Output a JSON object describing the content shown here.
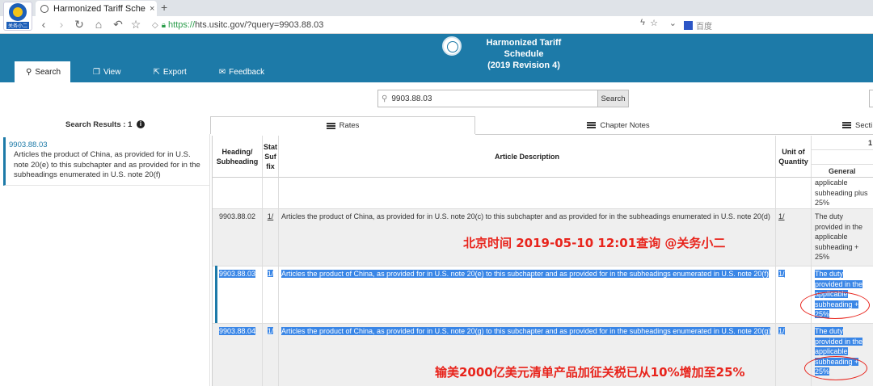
{
  "browser": {
    "logo_text": "关务小二",
    "tab_title": "Harmonized Tariff Sche",
    "tab_close": "×",
    "new_tab": "+",
    "url_scheme": "https://",
    "url_rest": "hts.usitc.gov/?query=9903.88.03",
    "search_engine": "百度"
  },
  "site": {
    "title_line1": "Harmonized Tariff Schedule",
    "title_line2": "(2019 Revision 4)",
    "menu": [
      {
        "label": "Search",
        "icon": "search-icon",
        "active": true
      },
      {
        "label": "View",
        "icon": "copy-icon"
      },
      {
        "label": "Export",
        "icon": "export-icon"
      },
      {
        "label": "Feedback",
        "icon": "feedback-icon"
      }
    ]
  },
  "search": {
    "value": "9903.88.03",
    "button": "Search"
  },
  "results": {
    "header": "Search Results : 1",
    "info_icon": "i",
    "item_code": "9903.88.03",
    "item_desc": "Articles the product of China, as provided for in U.S. note 20(e) to this subchapter and as provided for in the subheadings enumerated in U.S. note 20(f)"
  },
  "subtabs": [
    "Rates",
    "Chapter Notes",
    "Secti"
  ],
  "table": {
    "headers": {
      "heading": "Heading/ Subheading",
      "stat": "Stat Suf fix",
      "desc": "Article Description",
      "unit": "Unit of Quantity",
      "rates_top": "1",
      "general": "General"
    },
    "rows": [
      {
        "heading": "",
        "stat": "",
        "desc": "",
        "unit": "",
        "general": "applicable subheading plus 25%"
      },
      {
        "heading": "9903.88.02",
        "stat": "1/",
        "desc": "Articles the product of China, as provided for in U.S. note 20(c) to this subchapter and as provided for in the subheadings enumerated in U.S. note 20(d)",
        "unit": "1/",
        "general": "The duty provided in the applicable subheading + 25%"
      },
      {
        "heading": "9903.88.03",
        "stat": "1/",
        "desc": "Articles the product of China, as provided for in U.S. note 20(e) to this subchapter and as provided for in the subheadings enumerated in U.S. note 20(f)",
        "unit": "1/",
        "general": "The duty provided in the applicable subheading + 25%"
      },
      {
        "heading": "9903.88.04",
        "stat": "1/",
        "desc": "Articles the product of China, as provided for in U.S. note 20(g) to this subchapter and as provided for in the subheadings enumerated in U.S. note 20(g)",
        "unit": "1/",
        "general": "The duty provided in the applicable subheading + 25%"
      }
    ]
  },
  "annotations": {
    "timestamp": "北京时间 2019-05-10 12:01查询 @关务小二",
    "note": "输美2000亿美元清单产品加征关税已从10%增加至25%"
  },
  "colors": {
    "header_blue": "#1d7aa8",
    "selection": "#3a86e6",
    "annotation_red": "#e8241c"
  }
}
